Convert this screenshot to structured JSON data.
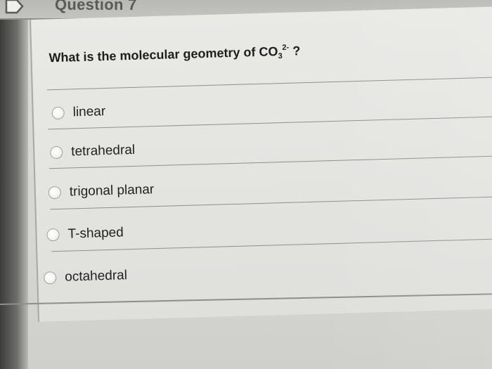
{
  "header": {
    "title": "Question 7"
  },
  "question": {
    "prefix": "What is the molecular geometry of CO",
    "subscript": "3",
    "superscript": "2-",
    "suffix": " ?"
  },
  "options": [
    {
      "label": "linear",
      "selected": false
    },
    {
      "label": "tetrahedral",
      "selected": false
    },
    {
      "label": "trigonal planar",
      "selected": false
    },
    {
      "label": "T-shaped",
      "selected": false
    },
    {
      "label": "octahedral",
      "selected": false
    }
  ],
  "colors": {
    "background": "#d9d9d6",
    "text": "#1e1e1e",
    "header_text": "#5a5a58",
    "divider": "#8f8f8b"
  },
  "icons": {
    "flag": "flag-icon",
    "radio": "radio-button-icon"
  }
}
